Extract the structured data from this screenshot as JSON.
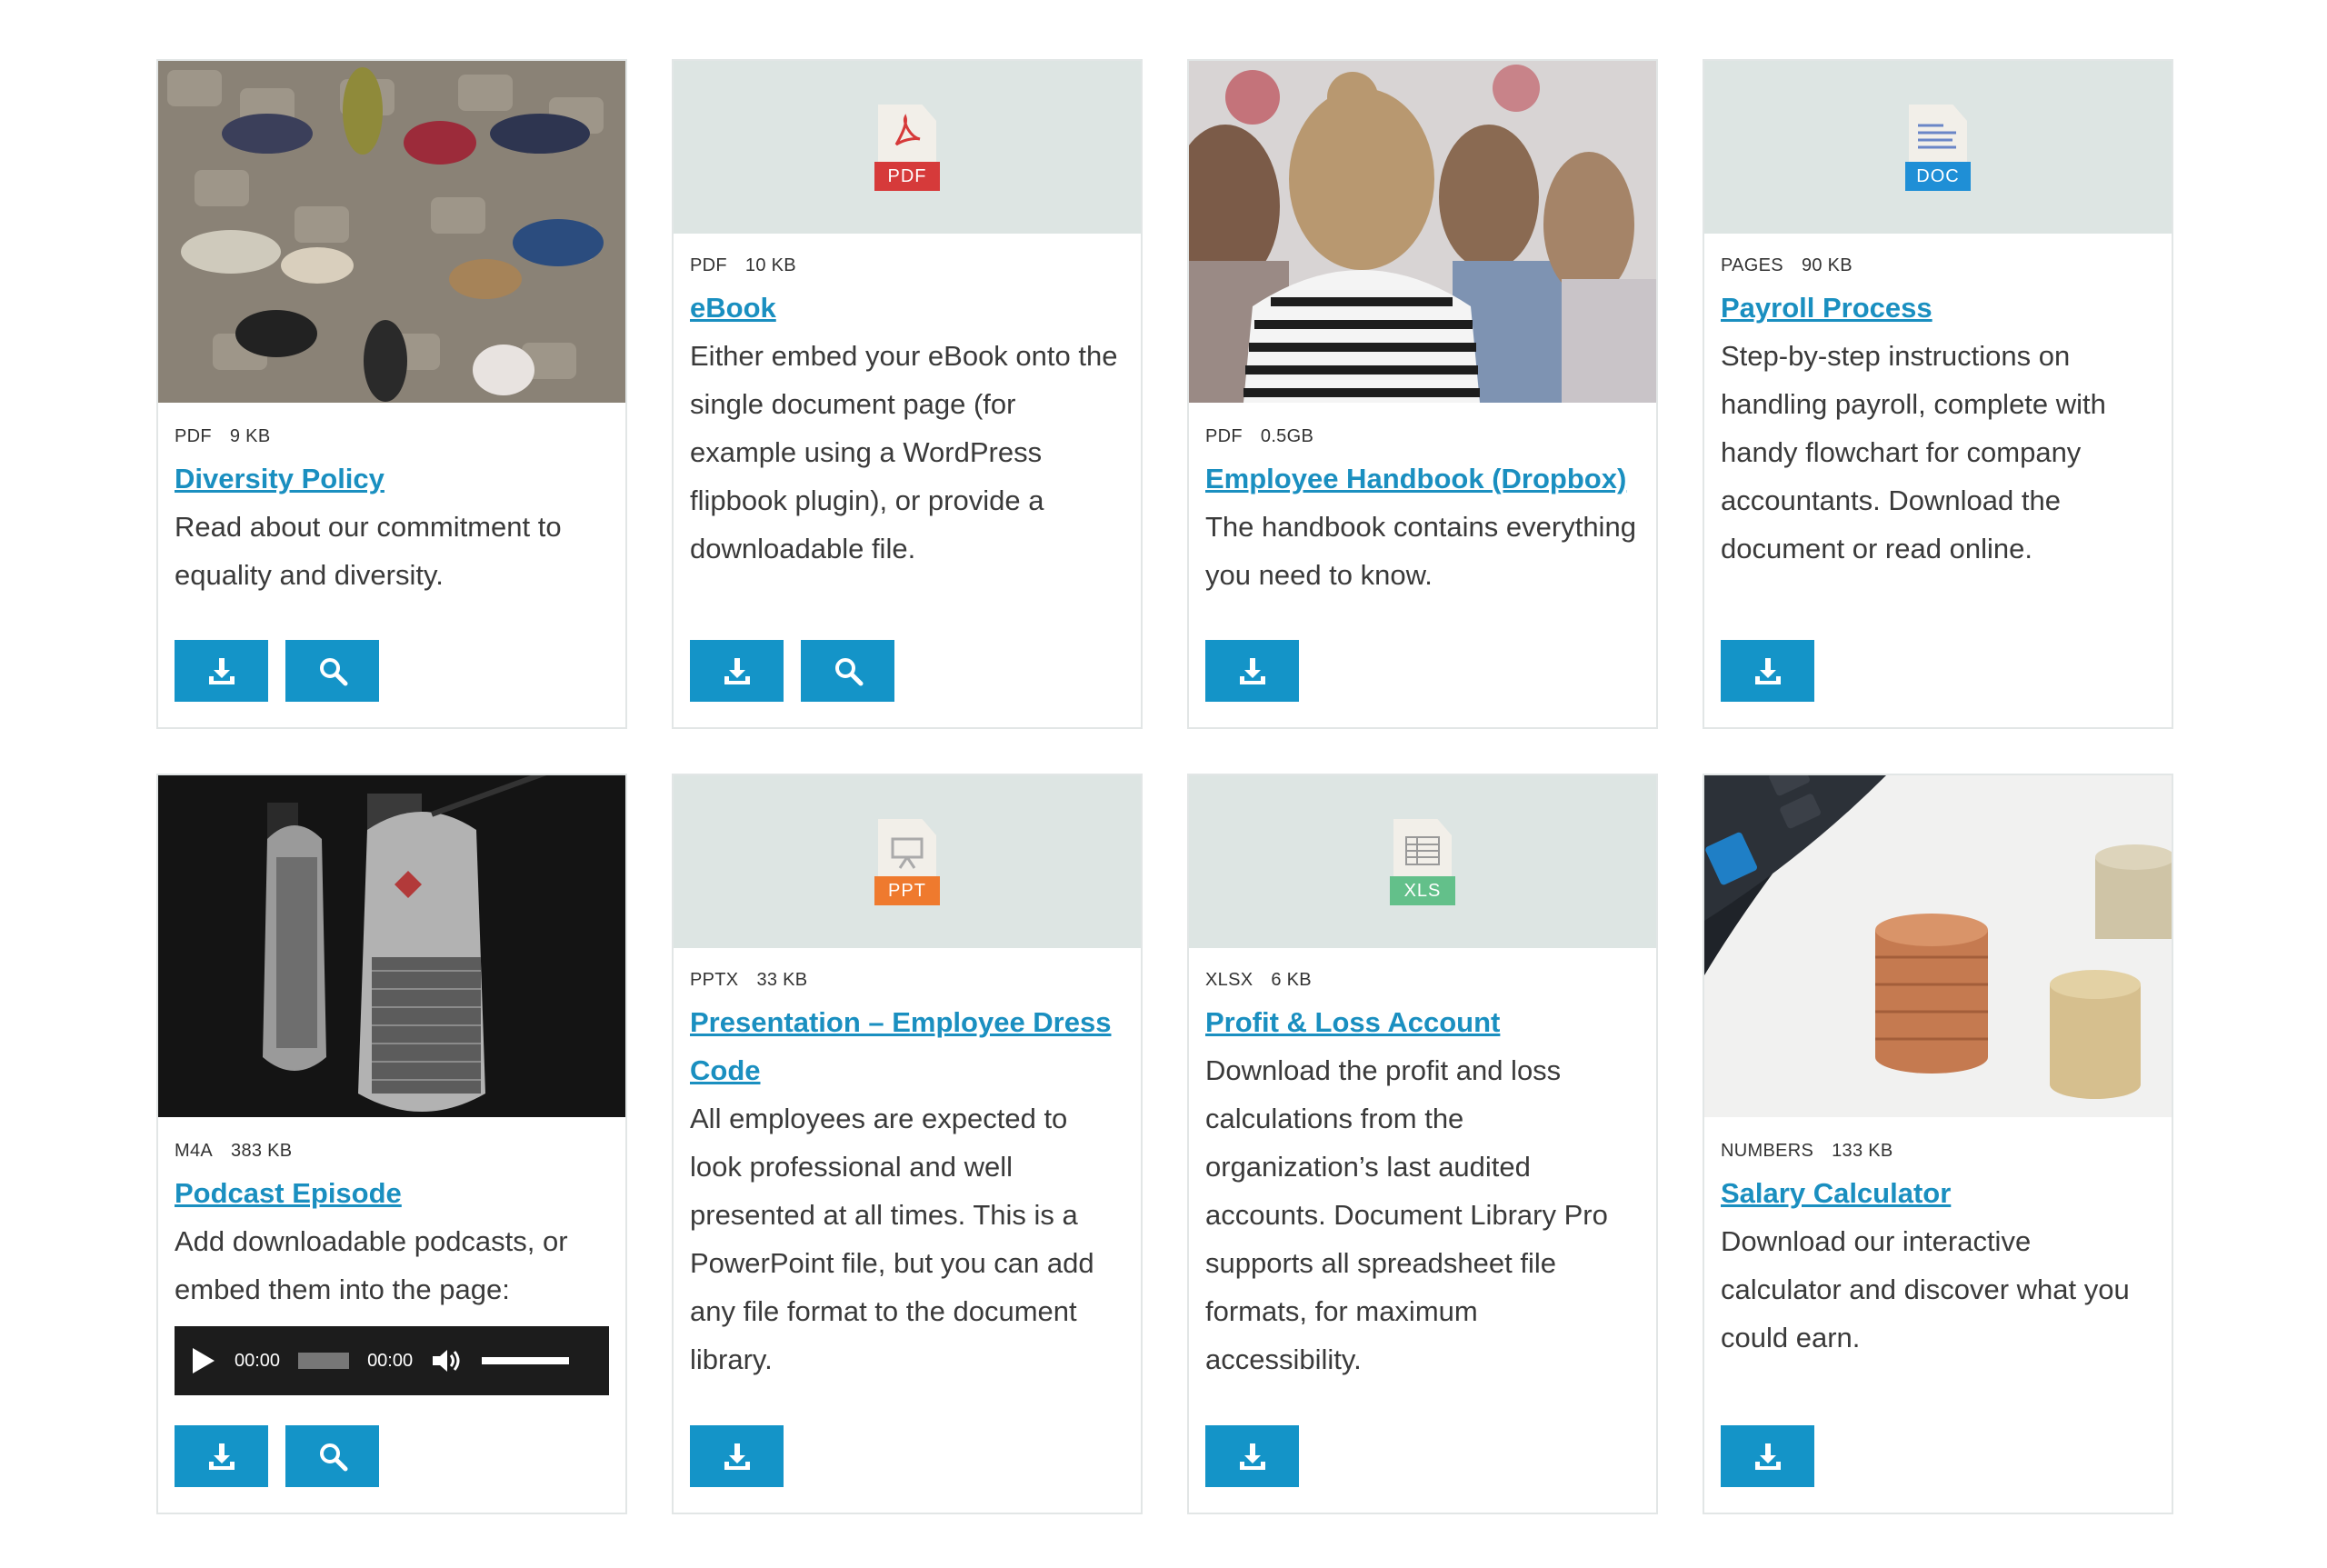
{
  "cards": [
    {
      "type": "PDF",
      "size": "9 KB",
      "title": "Diversity Policy",
      "desc": "Read about our commitment to equality and diversity.",
      "thumb": "photo-feet"
    },
    {
      "type": "PDF",
      "size": "10 KB",
      "title": "eBook",
      "desc": "Either embed your eBook onto the single document page (for example using a WordPress flipbook plugin), or provide a downloadable file.",
      "icon_label": "PDF",
      "icon_color": "#d63a3a"
    },
    {
      "type": "PDF",
      "size": "0.5GB",
      "title": "Employee Handbook (Dropbox)",
      "desc": "The handbook contains everything you need to know.",
      "thumb": "photo-people"
    },
    {
      "type": "PAGES",
      "size": "90 KB",
      "title": "Payroll Process",
      "desc": "Step-by-step instructions on handling payroll, complete with handy flowchart for company accountants. Download the document or read online.",
      "icon_label": "DOC",
      "icon_color": "#1f8fd6"
    },
    {
      "type": "M4A",
      "size": "383 KB",
      "title": "Podcast Episode",
      "desc": "Add downloadable podcasts, or embed them into the page:",
      "thumb": "photo-mics",
      "audio": {
        "current": "00:00",
        "duration": "00:00"
      }
    },
    {
      "type": "PPTX",
      "size": "33 KB",
      "title": "Presentation – Employee Dress Code",
      "desc": "All employees are expected to look professional and well presented at all times. This is a PowerPoint file, but you can add any file format to the document library.",
      "icon_label": "PPT",
      "icon_color": "#ef7a2e"
    },
    {
      "type": "XLSX",
      "size": "6 KB",
      "title": "Profit & Loss Account",
      "desc": "Download the profit and loss calculations from the organization’s last audited accounts. Document Library Pro supports all spreadsheet file formats, for maximum accessibility.",
      "icon_label": "XLS",
      "icon_color": "#63c08a"
    },
    {
      "type": "NUMBERS",
      "size": "133 KB",
      "title": "Salary Calculator",
      "desc": "Download our interactive calculator and discover what you could earn.",
      "thumb": "photo-coins"
    }
  ],
  "colors": {
    "accent": "#1494c8",
    "link": "#1a8fc0",
    "icon_bg": "#dde5e3"
  }
}
